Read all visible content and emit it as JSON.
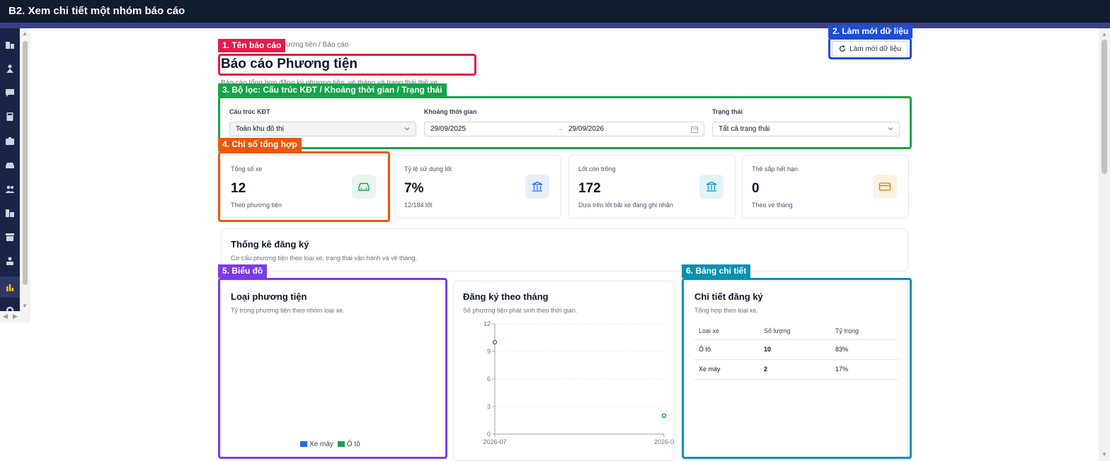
{
  "window": {
    "title": "B2. Xem chi tiết một nhóm báo cáo"
  },
  "annotations": [
    {
      "label": "1. Tên báo cáo",
      "color": "#e11d48"
    },
    {
      "label": "2. Làm mới dữ liệu",
      "color": "#1d4ed8"
    },
    {
      "label": "3. Bộ lọc: Cấu trúc KĐT / Khoảng thời gian / Trạng thái",
      "color": "#16a34a"
    },
    {
      "label": "4. Chỉ số tổng hợp",
      "color": "#ea580c"
    },
    {
      "label": "5. Biểu đồ",
      "color": "#7c3aed"
    },
    {
      "label": "6. Bảng chi tiết",
      "color": "#0891b2"
    }
  ],
  "header": {
    "breadcrumb": "ương tiện  /  Báo cáo",
    "title": "Báo cáo Phương tiện",
    "description": "Báo cáo tổng hợp đăng ký phương tiện, vé tháng và trạng thái thẻ xe.",
    "refresh_label": "Làm mới dữ liệu"
  },
  "filters": {
    "structure": {
      "label": "Cấu trúc KĐT",
      "value": "Toàn khu đô thị"
    },
    "period": {
      "label": "Khoảng thời gian",
      "from": "29/09/2025",
      "arrow": "→",
      "to": "29/09/2026"
    },
    "status": {
      "label": "Trạng thái",
      "value": "Tất cả trạng thái"
    }
  },
  "stats": [
    {
      "label": "Tổng số xe",
      "value": "12",
      "sub": "Theo phương tiện",
      "icon": "car-icon",
      "color": "#16a34a",
      "bg": "#e8f6ee"
    },
    {
      "label": "Tỷ lệ sử dụng lốt",
      "value": "7%",
      "sub": "12/184 lốt",
      "icon": "building-icon",
      "color": "#2563eb",
      "bg": "#e6effd"
    },
    {
      "label": "Lốt còn trống",
      "value": "172",
      "sub": "Dựa trên lốt bãi xe đang ghi nhận",
      "icon": "building-icon",
      "color": "#0891b2",
      "bg": "#e3f4f8"
    },
    {
      "label": "Thẻ sắp hết hạn",
      "value": "0",
      "sub": "Theo vé tháng",
      "icon": "card-icon",
      "color": "#d97706",
      "bg": "#fdf2e1"
    }
  ],
  "registration": {
    "title": "Thống kê đăng ký",
    "description": "Cơ cấu phương tiện theo loại xe, trạng thái vận hành và vé tháng."
  },
  "vehicle_type": {
    "title": "Loại phương tiện",
    "description": "Tỷ trọng phương tiện theo nhóm loại xe.",
    "legend": [
      {
        "name": "Xe máy",
        "color": "#2563eb"
      },
      {
        "name": "Ô tô",
        "color": "#16a34a"
      }
    ]
  },
  "monthly": {
    "title": "Đăng ký theo tháng",
    "description": "Số phương tiện phát sinh theo thời gian."
  },
  "chart_data": {
    "type": "line",
    "title": "Đăng ký theo tháng",
    "x": [
      "2026-07",
      "2026-0"
    ],
    "series": [
      {
        "values": [
          10,
          2
        ]
      }
    ],
    "yticks": [
      "0",
      "3",
      "6",
      "9",
      "12"
    ],
    "ylim": [
      0,
      12
    ],
    "grid": true
  },
  "detail": {
    "title": "Chi tiết đăng ký",
    "description": "Tổng hợp theo loại xe.",
    "columns": [
      "Loại xe",
      "Số lượng",
      "Tỷ trọng"
    ],
    "rows": [
      [
        "Ô tô",
        "10",
        "83%"
      ],
      [
        "Xe máy",
        "2",
        "17%"
      ]
    ]
  }
}
